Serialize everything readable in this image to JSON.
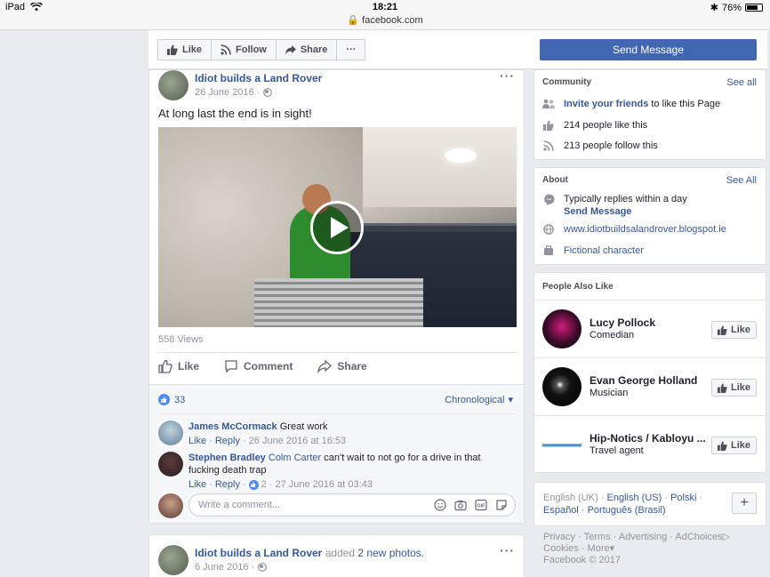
{
  "status_bar": {
    "device": "iPad",
    "time": "18:21",
    "url": "facebook.com",
    "battery": "76%",
    "battery_level": 0.76
  },
  "page_header": {
    "like_label": "Like",
    "follow_label": "Follow",
    "share_label": "Share",
    "more_label": "···",
    "send_message_label": "Send Message"
  },
  "post1": {
    "author": "Idiot builds a Land Rover",
    "date": "26 June 2016 ·",
    "text": "At long last the end is in sight!",
    "views": "558 Views",
    "actions": {
      "like": "Like",
      "comment": "Comment",
      "share": "Share"
    },
    "like_count": "33",
    "order": "Chronological",
    "comments": [
      {
        "name": "James McCormack",
        "text": "Great work",
        "like": "Like",
        "reply": "Reply",
        "time": "26 June 2016 at 16:53"
      },
      {
        "name": "Stephen Bradley",
        "tag": "Colm Carter",
        "text": "can't wait to not go for a drive in that fucking death trap",
        "like": "Like",
        "reply": "Reply",
        "reactions": "2",
        "time": "27 June 2016 at 03:43"
      }
    ],
    "comment_placeholder": "Write a comment..."
  },
  "post2": {
    "author": "Idiot builds a Land Rover",
    "action": "added",
    "object": "2 new photos.",
    "date": "6 June 2016 ·"
  },
  "community": {
    "title": "Community",
    "see_all": "See all",
    "invite_link": "Invite your friends",
    "invite_rest": "to like this Page",
    "likes": "214 people like this",
    "follows": "213 people follow this"
  },
  "about": {
    "title": "About",
    "see_all": "See All",
    "replies": "Typically replies within a day",
    "send_message": "Send Message",
    "website": "www.idiotbuildsalandrover.blogspot.ie",
    "category": "Fictional character"
  },
  "people_also_like": {
    "title": "People Also Like",
    "like_label": "Like",
    "items": [
      {
        "name": "Lucy Pollock",
        "sub": "Comedian"
      },
      {
        "name": "Evan George Holland",
        "sub": "Musician"
      },
      {
        "name": "Hip-Notics / Kabloyu ...",
        "sub": "Travel agent"
      }
    ]
  },
  "languages": {
    "current": "English (UK) ·",
    "options": [
      "English (US)",
      "Polski",
      "Español",
      "Português (Brasil)"
    ],
    "sep": "·",
    "plus": "+"
  },
  "footer": {
    "privacy": "Privacy",
    "terms": "Terms",
    "advertising": "Advertising",
    "adchoices": "AdChoices",
    "cookies": "Cookies",
    "more": "More",
    "copyright": "Facebook © 2017",
    "sep": "·"
  },
  "colors": {
    "fb_blue": "#4267b2",
    "link": "#365899",
    "background": "#e9ebee"
  }
}
